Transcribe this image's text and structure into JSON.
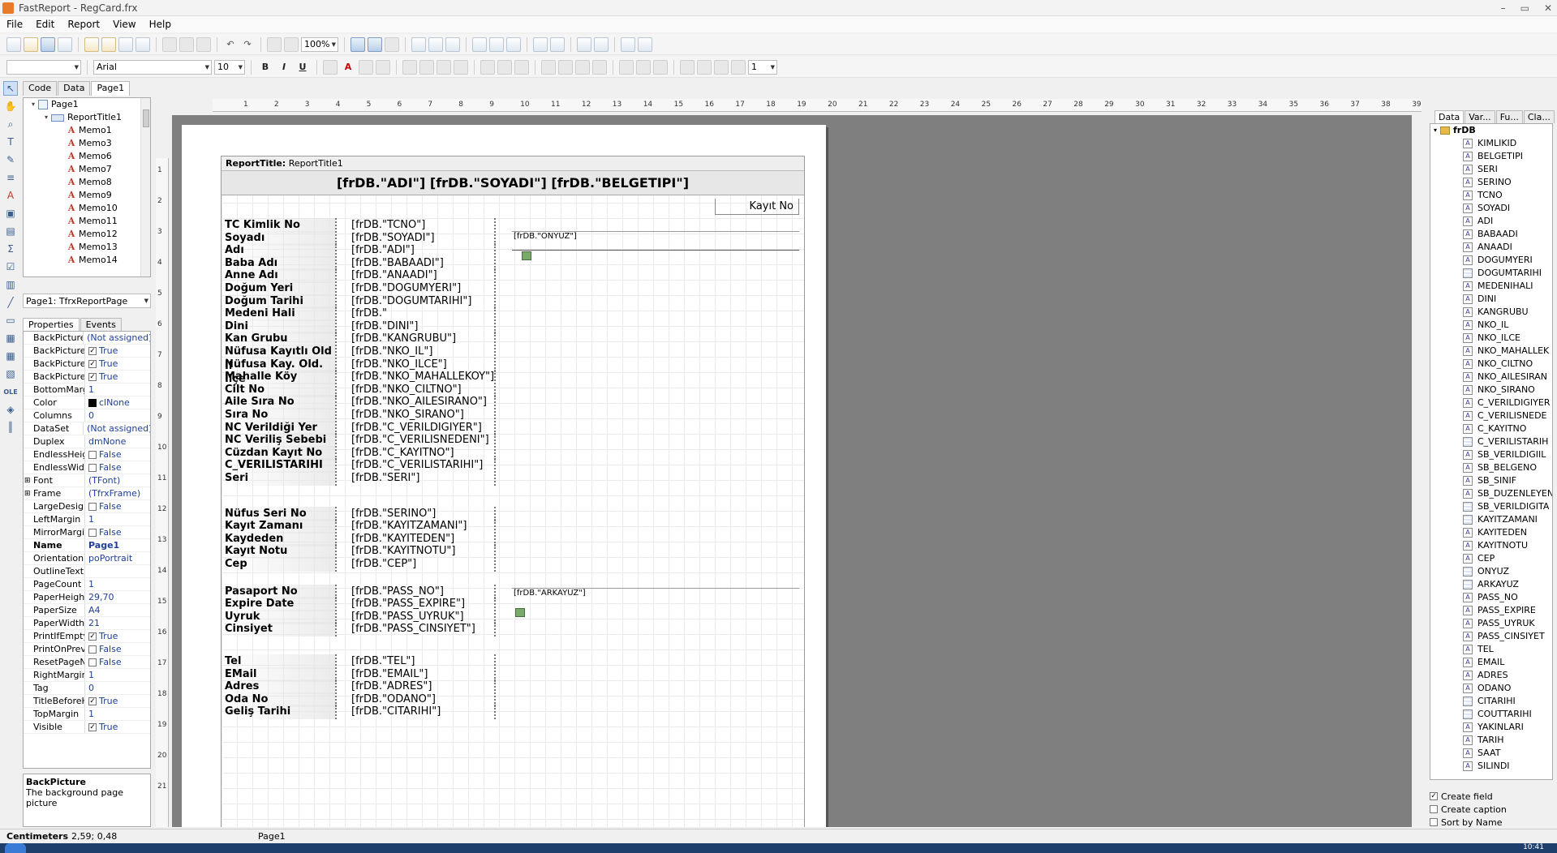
{
  "window": {
    "title": "FastReport - RegCard.frx",
    "min": "–",
    "max": "▭",
    "close": "✕"
  },
  "menu": [
    "File",
    "Edit",
    "Report",
    "View",
    "Help"
  ],
  "toolbar": {
    "zoom": "100%",
    "font_name": "Arial",
    "font_size": "10",
    "line_width": "1"
  },
  "page_tabs": [
    "Code",
    "Data",
    "Page1"
  ],
  "tree": {
    "page": "Page1",
    "band": "ReportTitle1",
    "memos": [
      "Memo1",
      "Memo3",
      "Memo6",
      "Memo7",
      "Memo8",
      "Memo9",
      "Memo10",
      "Memo11",
      "Memo12",
      "Memo13",
      "Memo14"
    ]
  },
  "inspector": {
    "object": "Page1: TfrxReportPage",
    "tabs": [
      "Properties",
      "Events"
    ],
    "rows": [
      {
        "name": "BackPicture",
        "value": "(Not assigned)"
      },
      {
        "name": "BackPicturePr",
        "value": "True",
        "check": true
      },
      {
        "name": "BackPictureSt",
        "value": "True",
        "check": true
      },
      {
        "name": "BackPictureVi",
        "value": "True",
        "check": true
      },
      {
        "name": "BottomMargin",
        "value": "1"
      },
      {
        "name": "Color",
        "value": "clNone",
        "swatch": true
      },
      {
        "name": "Columns",
        "value": "0"
      },
      {
        "name": "DataSet",
        "value": "(Not assigned)"
      },
      {
        "name": "Duplex",
        "value": "dmNone"
      },
      {
        "name": "EndlessHeigh",
        "value": "False",
        "check": false
      },
      {
        "name": "EndlessWidth",
        "value": "False",
        "check": false
      },
      {
        "name": "Font",
        "value": "(TFont)",
        "expand": true
      },
      {
        "name": "Frame",
        "value": "(TfrxFrame)",
        "expand": true
      },
      {
        "name": "LargeDesigne",
        "value": "False",
        "check": false
      },
      {
        "name": "LeftMargin",
        "value": "1"
      },
      {
        "name": "MirrorMargins",
        "value": "False",
        "check": false
      },
      {
        "name": "Name",
        "value": "Page1",
        "bold": true
      },
      {
        "name": "Orientation",
        "value": "poPortrait"
      },
      {
        "name": "OutlineText",
        "value": ""
      },
      {
        "name": "PageCount",
        "value": "1"
      },
      {
        "name": "PaperHeight",
        "value": "29,70"
      },
      {
        "name": "PaperSize",
        "value": "A4"
      },
      {
        "name": "PaperWidth",
        "value": "21"
      },
      {
        "name": "PrintIfEmpty",
        "value": "True",
        "check": true
      },
      {
        "name": "PrintOnPrevie",
        "value": "False",
        "check": false
      },
      {
        "name": "ResetPageNu",
        "value": "False",
        "check": false
      },
      {
        "name": "RightMargin",
        "value": "1"
      },
      {
        "name": "Tag",
        "value": "0"
      },
      {
        "name": "TitleBeforeHe",
        "value": "True",
        "check": true
      },
      {
        "name": "TopMargin",
        "value": "1"
      },
      {
        "name": "Visible",
        "value": "True",
        "check": true
      }
    ],
    "help_title": "BackPicture",
    "help_text": "The background page picture"
  },
  "report": {
    "band_caption": "ReportTitle:",
    "band_name": "ReportTitle1",
    "title_memo": "[frDB.\"ADI\"] [frDB.\"SOYADI\"]  [frDB.\"BELGETIPI\"]",
    "kayit_no": "Kayıt No",
    "onyuz": "[frDB.\"ONYUZ\"]",
    "arkayuz": "[frDB.\"ARKAYUZ\"]",
    "rows": [
      {
        "label": "TC Kimlik No",
        "field": "[frDB.\"TCNO\"]"
      },
      {
        "label": "Soyadı",
        "field": "[frDB.\"SOYADI\"]"
      },
      {
        "label": "Adı",
        "field": "[frDB.\"ADI\"]"
      },
      {
        "label": "Baba Adı",
        "field": "[frDB.\"BABAADI\"]"
      },
      {
        "label": "Anne Adı",
        "field": "[frDB.\"ANAADI\"]"
      },
      {
        "label": "Doğum Yeri",
        "field": "[frDB.\"DOGUMYERI\"]"
      },
      {
        "label": "Doğum Tarihi",
        "field": "[frDB.\"DOGUMTARIHI\"]"
      },
      {
        "label": "Medeni Hali",
        "field": "[frDB.\""
      },
      {
        "label": "Dini",
        "field": "[frDB.\"DINI\"]"
      },
      {
        "label": "Kan Grubu",
        "field": "[frDB.\"KANGRUBU\"]"
      },
      {
        "label": "Nüfusa Kayıtlı Old İl",
        "field": "[frDB.\"NKO_IL\"]"
      },
      {
        "label": "Nüfusa Kay. Old. İlçe",
        "field": "[frDB.\"NKO_ILCE\"]"
      },
      {
        "label": "Mahalle Köy",
        "field": "[frDB.\"NKO_MAHALLEKOY\"]"
      },
      {
        "label": "Cilt No",
        "field": "[frDB.\"NKO_CILTNO\"]"
      },
      {
        "label": "Aile Sıra No",
        "field": "[frDB.\"NKO_AILESIRANO\"]"
      },
      {
        "label": "Sıra No",
        "field": "[frDB.\"NKO_SIRANO\"]"
      },
      {
        "label": "NC Verildiği Yer",
        "field": "[frDB.\"C_VERILDIGIYER\"]"
      },
      {
        "label": "NC Veriliş Sebebi",
        "field": "[frDB.\"C_VERILISNEDENI\"]"
      },
      {
        "label": "Cüzdan Kayıt No",
        "field": "[frDB.\"C_KAYITNO\"]"
      },
      {
        "label": "C_VERILISTARIHI",
        "field": "[frDB.\"C_VERILISTARIHI\"]"
      },
      {
        "label": "Seri",
        "field": "[frDB.\"SERI\"]"
      },
      {
        "label": "Nüfus Seri No",
        "field": "[frDB.\"SERINO\"]"
      },
      {
        "label": "Kayıt Zamanı",
        "field": "[frDB.\"KAYITZAMANI\"]"
      },
      {
        "label": "Kaydeden",
        "field": "[frDB.\"KAYITEDEN\"]"
      },
      {
        "label": "Kayıt Notu",
        "field": "[frDB.\"KAYITNOTU\"]"
      },
      {
        "label": "Cep",
        "field": "[frDB.\"CEP\"]"
      },
      {
        "label": "Pasaport No",
        "field": "[frDB.\"PASS_NO\"]"
      },
      {
        "label": "Expire Date",
        "field": "[frDB.\"PASS_EXPIRE\"]"
      },
      {
        "label": "Uyruk",
        "field": "[frDB.\"PASS_UYRUK\"]"
      },
      {
        "label": "Cinsiyet",
        "field": "[frDB.\"PASS_CINSIYET\"]"
      },
      {
        "label": "Tel",
        "field": "[frDB.\"TEL\"]"
      },
      {
        "label": "EMail",
        "field": "[frDB.\"EMAIL\"]"
      },
      {
        "label": "Adres",
        "field": "[frDB.\"ADRES\"]"
      },
      {
        "label": "Oda No",
        "field": "[frDB.\"ODANO\"]"
      },
      {
        "label": "Geliş Tarihi",
        "field": "[frDB.\"CITARIHI\"]"
      }
    ]
  },
  "right_panel": {
    "tabs": [
      "Data",
      "Var...",
      "Fu...",
      "Cla..."
    ],
    "root": "frDB",
    "fields": [
      "KIMLIKID",
      "BELGETIPI",
      "SERI",
      "SERINO",
      "TCNO",
      "SOYADI",
      "ADI",
      "BABAADI",
      "ANAADI",
      "DOGUMYERI",
      "DOGUMTARIHI",
      "MEDENIHALI",
      "DINI",
      "KANGRUBU",
      "NKO_IL",
      "NKO_ILCE",
      "NKO_MAHALLEK",
      "NKO_CILTNO",
      "NKO_AILESIRAN",
      "NKO_SIRANO",
      "C_VERILDIGIYER",
      "C_VERILISNEDE",
      "C_KAYITNO",
      "C_VERILISTARIH",
      "SB_VERILDIGIIL",
      "SB_BELGENO",
      "SB_SINIF",
      "SB_DUZENLEYEN",
      "SB_VERILDIGITA",
      "KAYITZAMANI",
      "KAYITEDEN",
      "KAYITNOTU",
      "CEP",
      "ONYUZ",
      "ARKAYUZ",
      "PASS_NO",
      "PASS_EXPIRE",
      "PASS_UYRUK",
      "PASS_CINSIYET",
      "TEL",
      "EMAIL",
      "ADRES",
      "ODANO",
      "CITARIHI",
      "COUTTARIHI",
      "YAKINLARI",
      "TARIH",
      "SAAT",
      "SILINDI"
    ],
    "options": [
      {
        "label": "Create field",
        "checked": true
      },
      {
        "label": "Create caption",
        "checked": false
      },
      {
        "label": "Sort by Name",
        "checked": false
      }
    ]
  },
  "status": {
    "units": "Centimeters",
    "coords": "2,59; 0,48",
    "page": "Page1"
  },
  "taskbar": {
    "clock": "10:41"
  },
  "ruler": {
    "h_ticks": [
      "1",
      "2",
      "3",
      "4",
      "5",
      "6",
      "7",
      "8",
      "9",
      "10",
      "11",
      "12",
      "13",
      "14",
      "15",
      "16",
      "17",
      "18",
      "19",
      "20",
      "21",
      "22",
      "23",
      "24",
      "25",
      "26",
      "27",
      "28",
      "29",
      "30",
      "31",
      "32",
      "33",
      "34",
      "35",
      "36",
      "37",
      "38",
      "39"
    ],
    "v_ticks": [
      "1",
      "2",
      "3",
      "4",
      "5",
      "6",
      "7",
      "8",
      "9",
      "10",
      "11",
      "12",
      "13",
      "14",
      "15",
      "16",
      "17",
      "18",
      "19",
      "20",
      "21"
    ]
  }
}
